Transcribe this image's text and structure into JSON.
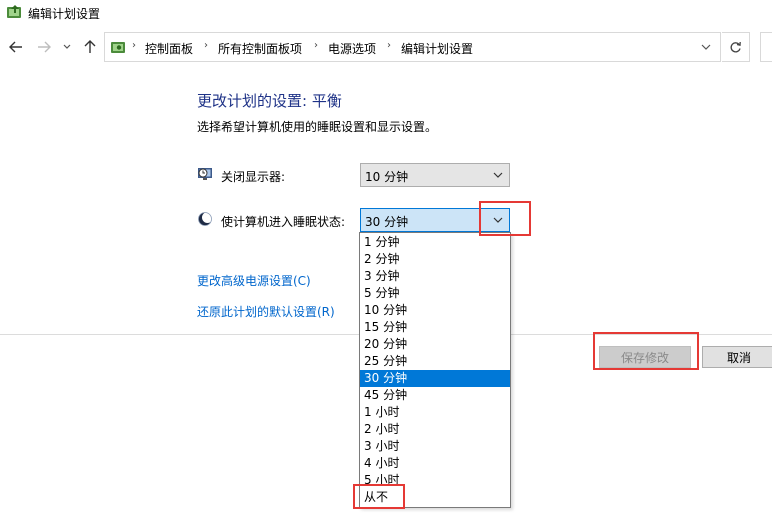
{
  "window": {
    "title": "编辑计划设置"
  },
  "navbar": {
    "back_icon": "arrow-left-icon",
    "forward_icon": "arrow-right-icon",
    "recent_icon": "chevron-down-icon",
    "up_icon": "arrow-up-icon",
    "breadcrumbs": [
      "控制面板",
      "所有控制面板项",
      "电源选项",
      "编辑计划设置"
    ],
    "refresh_icon": "refresh-icon"
  },
  "main": {
    "heading": "更改计划的设置: 平衡",
    "subheading": "选择希望计算机使用的睡眠设置和显示设置。",
    "display_off": {
      "label": "关闭显示器:",
      "value": "10 分钟",
      "icon": "monitor-clock-icon"
    },
    "sleep": {
      "label": "使计算机进入睡眠状态:",
      "value": "30 分钟",
      "icon": "moon-icon"
    },
    "links": {
      "advanced": "更改高级电源设置(C)",
      "restore": "还原此计划的默认设置(R)"
    },
    "buttons": {
      "save": "保存修改",
      "cancel": "取消"
    }
  },
  "dropdown": {
    "options": [
      "1 分钟",
      "2 分钟",
      "3 分钟",
      "5 分钟",
      "10 分钟",
      "15 分钟",
      "20 分钟",
      "25 分钟",
      "30 分钟",
      "45 分钟",
      "1 小时",
      "2 小时",
      "3 小时",
      "4 小时",
      "5 小时",
      "从不"
    ],
    "selected": "30 分钟"
  },
  "colors": {
    "heading": "#1e3287",
    "link": "#0066cc",
    "selection": "#0078d7",
    "highlight": "#e53935"
  }
}
